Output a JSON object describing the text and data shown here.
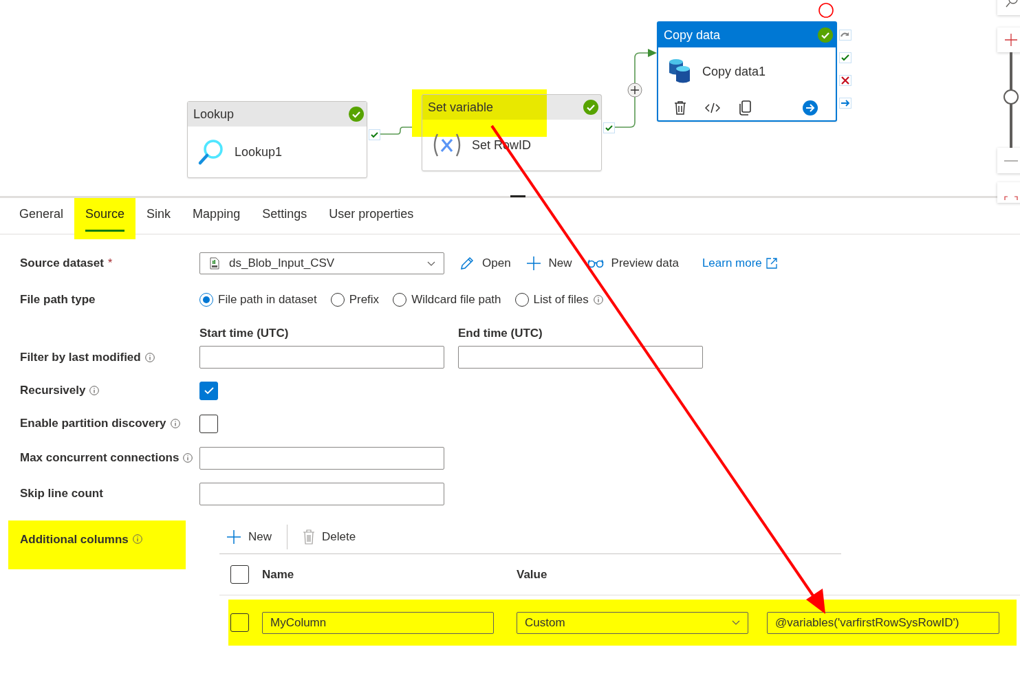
{
  "canvas": {
    "zoom": {
      "level": 0.55
    },
    "activities": [
      {
        "kind": "lookup",
        "type": "Lookup",
        "name": "Lookup1",
        "selected": false,
        "highlighted": false
      },
      {
        "kind": "set_variable",
        "type": "Set variable",
        "name": "Set RowID",
        "selected": false,
        "highlighted": true
      },
      {
        "kind": "copy",
        "type": "Copy data",
        "name": "Copy data1",
        "selected": true,
        "highlighted": false
      }
    ]
  },
  "tabs": [
    {
      "label": "General",
      "selected": false,
      "highlighted": false
    },
    {
      "label": "Source",
      "selected": true,
      "highlighted": true
    },
    {
      "label": "Sink",
      "selected": false,
      "highlighted": false
    },
    {
      "label": "Mapping",
      "selected": false,
      "highlighted": false
    },
    {
      "label": "Settings",
      "selected": false,
      "highlighted": false
    },
    {
      "label": "User properties",
      "selected": false,
      "highlighted": false
    }
  ],
  "fields": [
    {
      "kind": "dataset",
      "label": "Source dataset",
      "marker": "*",
      "info": false,
      "value": "ds_Blob_Input_CSV",
      "actions": [
        {
          "kind": "open",
          "label": "Open"
        },
        {
          "kind": "new",
          "label": "New"
        },
        {
          "kind": "preview",
          "label": "Preview data"
        },
        {
          "kind": "link",
          "label": "Learn more"
        }
      ]
    },
    {
      "kind": "radio",
      "label": "File path type",
      "info": false,
      "options": [
        {
          "label": "File path in dataset",
          "selected": true,
          "info": false
        },
        {
          "label": "Prefix",
          "selected": false,
          "info": false
        },
        {
          "label": "Wildcard file path",
          "selected": false,
          "info": false
        },
        {
          "label": "List of files",
          "selected": false,
          "info": true
        }
      ]
    },
    {
      "kind": "time_range",
      "label": "Filter by last modified",
      "info": true,
      "start_label": "Start time (UTC)",
      "end_label": "End time (UTC)"
    },
    {
      "kind": "checkbox",
      "label": "Recursively",
      "info": true,
      "checked": true
    },
    {
      "kind": "checkbox",
      "label": "Enable partition discovery",
      "info": true,
      "checked": false
    },
    {
      "kind": "text",
      "label": "Max concurrent connections",
      "info": true
    },
    {
      "kind": "text",
      "label": "Skip line count",
      "info": false
    }
  ],
  "additional_columns": {
    "label": "Additional columns",
    "info": true,
    "highlighted": true,
    "toolbar": [
      {
        "kind": "new",
        "label": "New",
        "disabled": false
      },
      {
        "kind": "delete",
        "label": "Delete",
        "disabled": true
      }
    ],
    "all_checked": false,
    "columns": [
      "Name",
      "Value"
    ],
    "rows": [
      {
        "checked": false,
        "highlighted": true,
        "name": "MyColumn",
        "value_type": "Custom",
        "value": "@variables('varfirstRowSysRowID')"
      }
    ]
  },
  "annotations": [
    {
      "kind": "arrow"
    },
    {
      "kind": "circle"
    }
  ]
}
